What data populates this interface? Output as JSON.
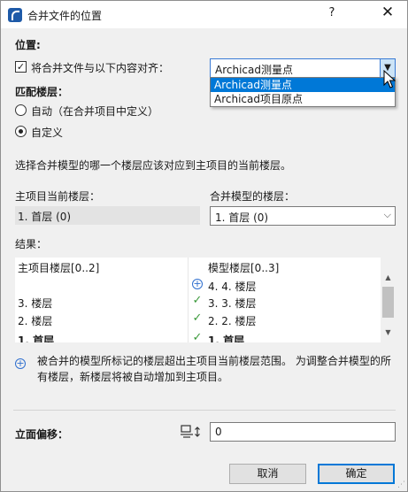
{
  "window": {
    "title": "合并文件的位置",
    "help_label": "?",
    "close_label": "✕"
  },
  "position": {
    "heading": "位置:",
    "align_checkbox": {
      "checked": true,
      "label": "将合并文件与以下内容对齐："
    },
    "align_select": {
      "value": "Archicad测量点",
      "options": [
        "Archicad测量点",
        "Archicad项目原点"
      ],
      "highlighted": 0
    }
  },
  "story_match": {
    "heading": "匹配楼层：",
    "options": [
      {
        "label": "自动（在合并项目中定义）",
        "selected": false
      },
      {
        "label": "自定义",
        "selected": true
      }
    ],
    "instruction": "选择合并模型的哪一个楼层应该对应到主项目的当前楼层。",
    "host_label": "主项目当前楼层：",
    "host_value": "1. 首层 (0)",
    "merged_label": "合并模型的楼层：",
    "merged_value": "1. 首层 (0)"
  },
  "results": {
    "heading": "结果：",
    "col_left": "主项目楼层[0..2]",
    "col_right": "模型楼层[0..3]",
    "rows": [
      {
        "left": "",
        "mark": "plus",
        "right": "4. 4. 楼层",
        "bold": false
      },
      {
        "left": "3. 楼层",
        "mark": "check",
        "right": "3. 3. 楼层",
        "bold": false
      },
      {
        "left": "2. 楼层",
        "mark": "check",
        "right": "2. 2. 楼层",
        "bold": false
      },
      {
        "left": "1. 首层",
        "mark": "check",
        "right": "1. 首层",
        "bold": true
      }
    ]
  },
  "note": "被合并的模型所标记的楼层超出主项目当前楼层范围。 为调整合并模型的所有楼层，新楼层将被自动增加到主项目。",
  "elevation_offset": {
    "label": "立面偏移：",
    "value": "0"
  },
  "buttons": {
    "cancel": "取消",
    "ok": "确定"
  },
  "icons": {
    "app": "archicad-app-icon",
    "info": "plus-circle-icon",
    "check": "check-icon",
    "elevation": "elevation-offset-icon",
    "arrow": "chevron-down-icon"
  },
  "colors": {
    "accent": "#0078d7",
    "check": "#3c9a3c",
    "info": "#2f6fcf"
  }
}
